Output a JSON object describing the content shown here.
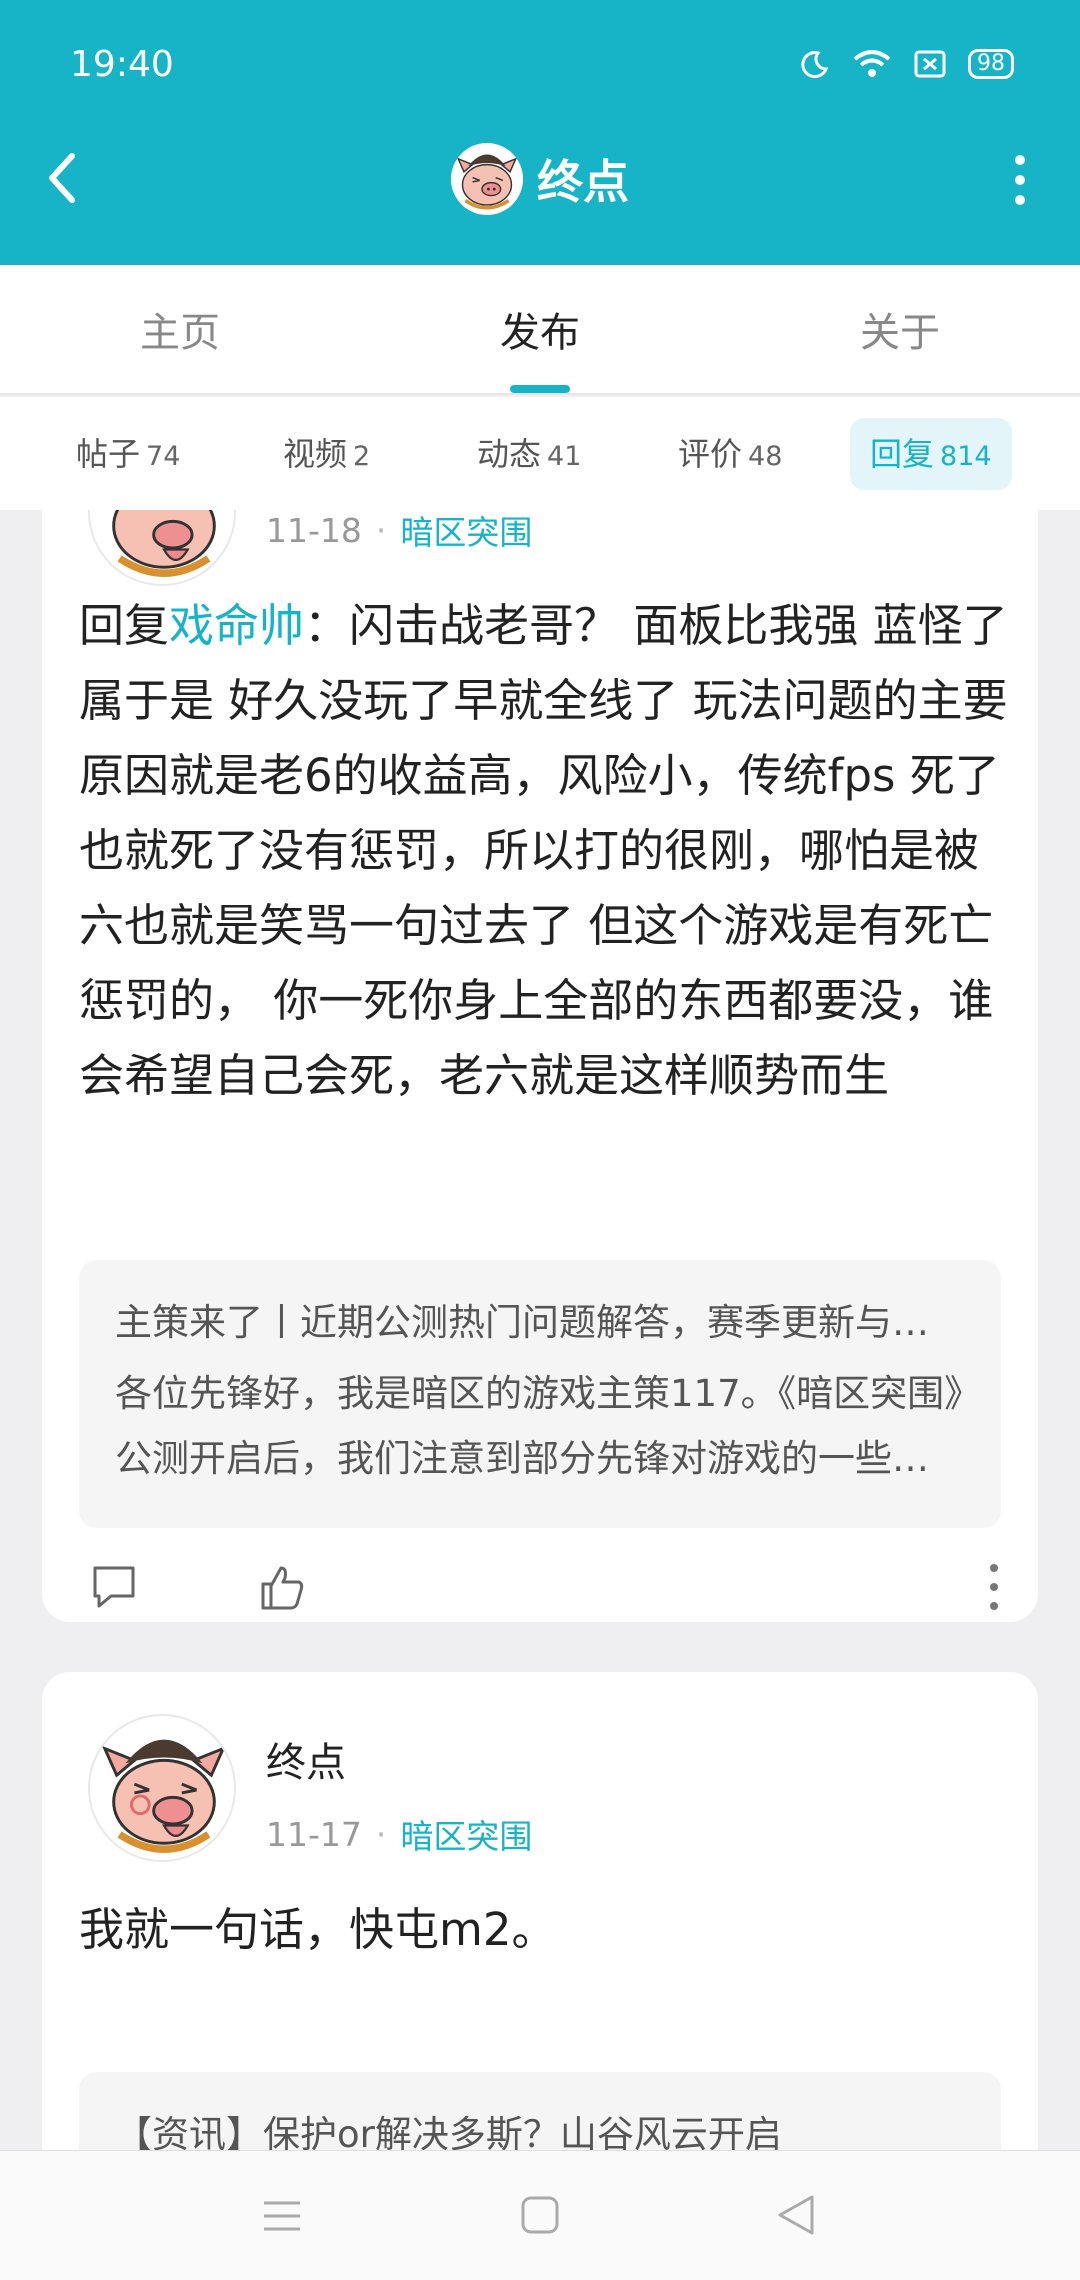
{
  "status_bar": {
    "time": "19:40",
    "battery": "98"
  },
  "header": {
    "title": "终点"
  },
  "main_tabs": [
    {
      "label": "主页"
    },
    {
      "label": "发布"
    },
    {
      "label": "关于"
    }
  ],
  "active_main_tab": "发布",
  "sub_tabs": [
    {
      "label": "帖子",
      "count": "74"
    },
    {
      "label": "视频",
      "count": "2"
    },
    {
      "label": "动态",
      "count": "41"
    },
    {
      "label": "评价",
      "count": "48"
    },
    {
      "label": "回复",
      "count": "814"
    }
  ],
  "active_sub_tab": "回复",
  "posts": [
    {
      "date": "11-18",
      "separator": "·",
      "game": "暗区突围",
      "reply_prefix": "回复",
      "reply_to": "戏命帅",
      "body": "：闪击战老哥？ 面板比我强 蓝怪了属于是 好久没玩了早就全线了 玩法问题的主要原因就是老6的收益高，风险小，传统fps 死了也就死了没有惩罚，所以打的很刚，哪怕是被六也就是笑骂一句过去了 但这个游戏是有死亡惩罚的， 你一死你身上全部的东西都要没，谁会希望自己会死，老六就是这样顺势而生",
      "quote_title": "主策来了丨近期公测热门问题解答，赛季更新与后续规划",
      "quote_desc": "各位先锋好，我是暗区的游戏主策117。《暗区突围》公测开启后，我们注意到部分先锋对游戏的一些问题"
    },
    {
      "author": "终点",
      "date": "11-17",
      "separator": "·",
      "game": "暗区突围",
      "body": "我就一句话，快屯m2。",
      "quote_title": "【资讯】保护or解决多斯？山谷风云开启"
    }
  ],
  "colors": {
    "accent": "#17b4c8",
    "header_bg": "#17b4c8",
    "page_bg": "#efeff1"
  }
}
